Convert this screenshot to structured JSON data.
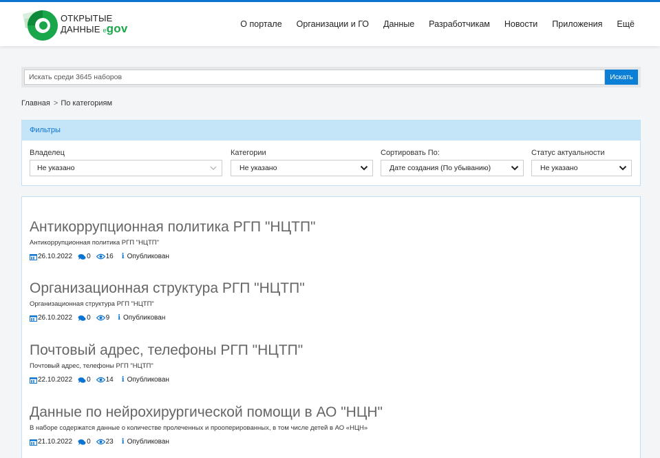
{
  "header": {
    "logo": {
      "line1": "ОТКРЫТЫЕ",
      "line2": "ДАННЫЕ",
      "e": "e",
      "gov": "gov"
    },
    "nav": [
      "О портале",
      "Организации и ГО",
      "Данные",
      "Разработчикам",
      "Новости",
      "Приложения",
      "Ещё"
    ]
  },
  "search": {
    "placeholder": "Искать среди 3645 наборов",
    "button": "Искать"
  },
  "breadcrumb": {
    "home": "Главная",
    "separator": ">",
    "current": "По категориям"
  },
  "filters": {
    "title": "Фильтры",
    "owner": {
      "label": "Владелец",
      "value": "Не указано"
    },
    "categories": {
      "label": "Категории",
      "value": "Не указано"
    },
    "sort": {
      "label": "Сортировать По:",
      "value": "Дате создания (По убыванию)"
    },
    "status": {
      "label": "Статус актуальности",
      "value": "Не указано"
    }
  },
  "colors": {
    "accent": "#0b74d1",
    "brand_green": "#1aa64a",
    "filter_header_bg": "#c4e4f8"
  },
  "items": [
    {
      "title": "Антикоррупционная политика РГП \"НЦТП\"",
      "description": "Антикоррупционная политика РГП \"НЦТП\"",
      "date": "26.10.2022",
      "comments": "0",
      "views": "16",
      "status": "Опубликован"
    },
    {
      "title": "Организационная структура РГП \"НЦТП\"",
      "description": "Организационная структура РГП \"НЦТП\"",
      "date": "26.10.2022",
      "comments": "0",
      "views": "9",
      "status": "Опубликован"
    },
    {
      "title": "Почтовый адрес, телефоны РГП \"НЦТП\"",
      "description": "Почтовый адрес, телефоны РГП \"НЦТП\"",
      "date": "22.10.2022",
      "comments": "0",
      "views": "14",
      "status": "Опубликован"
    },
    {
      "title": "Данные по нейрохирургической помощи в АО \"НЦН\"",
      "description": "В наборе содержатся данные о количестве пролеченных и прооперированных, в том числе детей в АО «НЦН»",
      "date": "21.10.2022",
      "comments": "0",
      "views": "23",
      "status": "Опубликован"
    }
  ]
}
